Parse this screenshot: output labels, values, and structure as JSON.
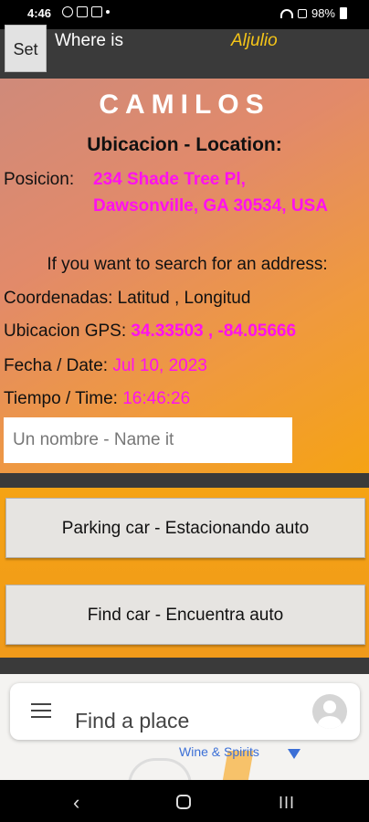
{
  "status_bar": {
    "time": "4:46",
    "battery": "98%"
  },
  "app_bar": {
    "set_label": "Set",
    "where_label": "Where is",
    "user_name": "Aljulio"
  },
  "main": {
    "app_title": "CAMILOS",
    "heading": "Ubicacion - Location:",
    "position_label": "Posicion:",
    "address_line1": "234 Shade Tree Pl,",
    "address_line2": "Dawsonville, GA 30534, USA",
    "search_hint": "If you want to search for an address:",
    "coords_label": "Coordenadas: Latitud , Longitud",
    "gps_label": "Ubicacion GPS:",
    "gps_value": "34.33503 , -84.05666",
    "date_label": "Fecha / Date:",
    "date_value": "Jul 10, 2023",
    "time_label": "Tiempo / Time:",
    "time_value": "16:46:26",
    "name_placeholder": "Un nombre - Name it"
  },
  "buttons": {
    "parking": "Parking car - Estacionando auto",
    "find": "Find car - Encuentra auto"
  },
  "map": {
    "search_placeholder": "Find a place",
    "poi_label": "Wine & Spirits"
  },
  "nav": {
    "back": "‹",
    "recents": "III"
  },
  "colors": {
    "accent_magenta": "#ff10f0",
    "user_name_yellow": "#f5c518",
    "panel_orange": "#f5a314"
  }
}
